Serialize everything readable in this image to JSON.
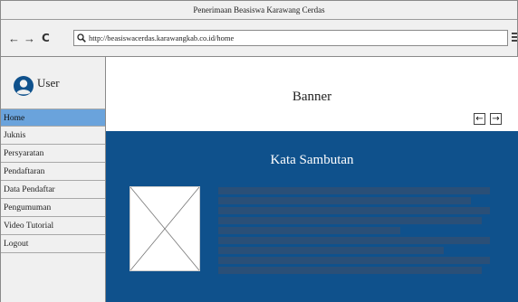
{
  "window": {
    "title": "Penerimaan Beasiswa Karawang Cerdas"
  },
  "toolbar": {
    "back_icon": "←",
    "forward_icon": "→",
    "reload_icon": "C",
    "url": "http://beasiswacerdas.karawangkab.co.id/home"
  },
  "sidebar": {
    "user_label": "User",
    "items": [
      {
        "label": "Home",
        "active": true
      },
      {
        "label": "Juknis"
      },
      {
        "label": "Persyaratan"
      },
      {
        "label": "Pendaftaran"
      },
      {
        "label": "Data Pendaftar"
      },
      {
        "label": "Pengumuman"
      },
      {
        "label": "Video Tutorial"
      },
      {
        "label": "Logout"
      }
    ]
  },
  "banner": {
    "title": "Banner",
    "prev": "←",
    "next": "→"
  },
  "welcome": {
    "title": "Kata Sambutan",
    "line_fractions": [
      1.0,
      0.93,
      1.0,
      0.97,
      0.67,
      1.0,
      0.83,
      1.0,
      0.97
    ]
  },
  "colors": {
    "accent": "#6aa3dc",
    "welcome_bg": "#0f518c",
    "line": "#2a4f77"
  }
}
